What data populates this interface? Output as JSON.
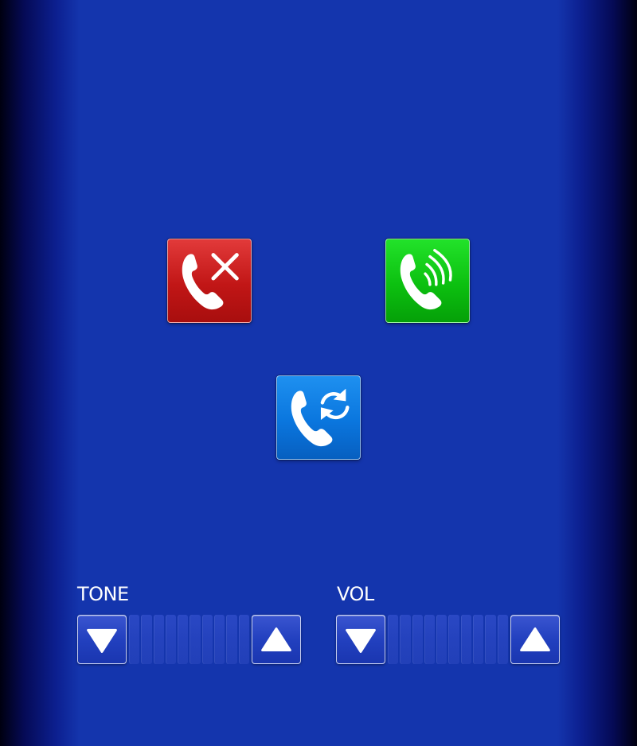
{
  "colors": {
    "background": "#1435ad",
    "hangup": "#c11616",
    "answer": "#0cc010",
    "transfer": "#0a76de",
    "icon": "#ffffff"
  },
  "call_buttons": {
    "hangup": {
      "icon": "phone-hangup-icon"
    },
    "answer": {
      "icon": "phone-ringing-icon"
    },
    "transfer": {
      "icon": "phone-transfer-icon"
    }
  },
  "controls": {
    "tone": {
      "label": "TONE",
      "down_icon": "triangle-down-icon",
      "up_icon": "triangle-up-icon",
      "segments": 10
    },
    "vol": {
      "label": "VOL",
      "down_icon": "triangle-down-icon",
      "up_icon": "triangle-up-icon",
      "segments": 10
    }
  }
}
